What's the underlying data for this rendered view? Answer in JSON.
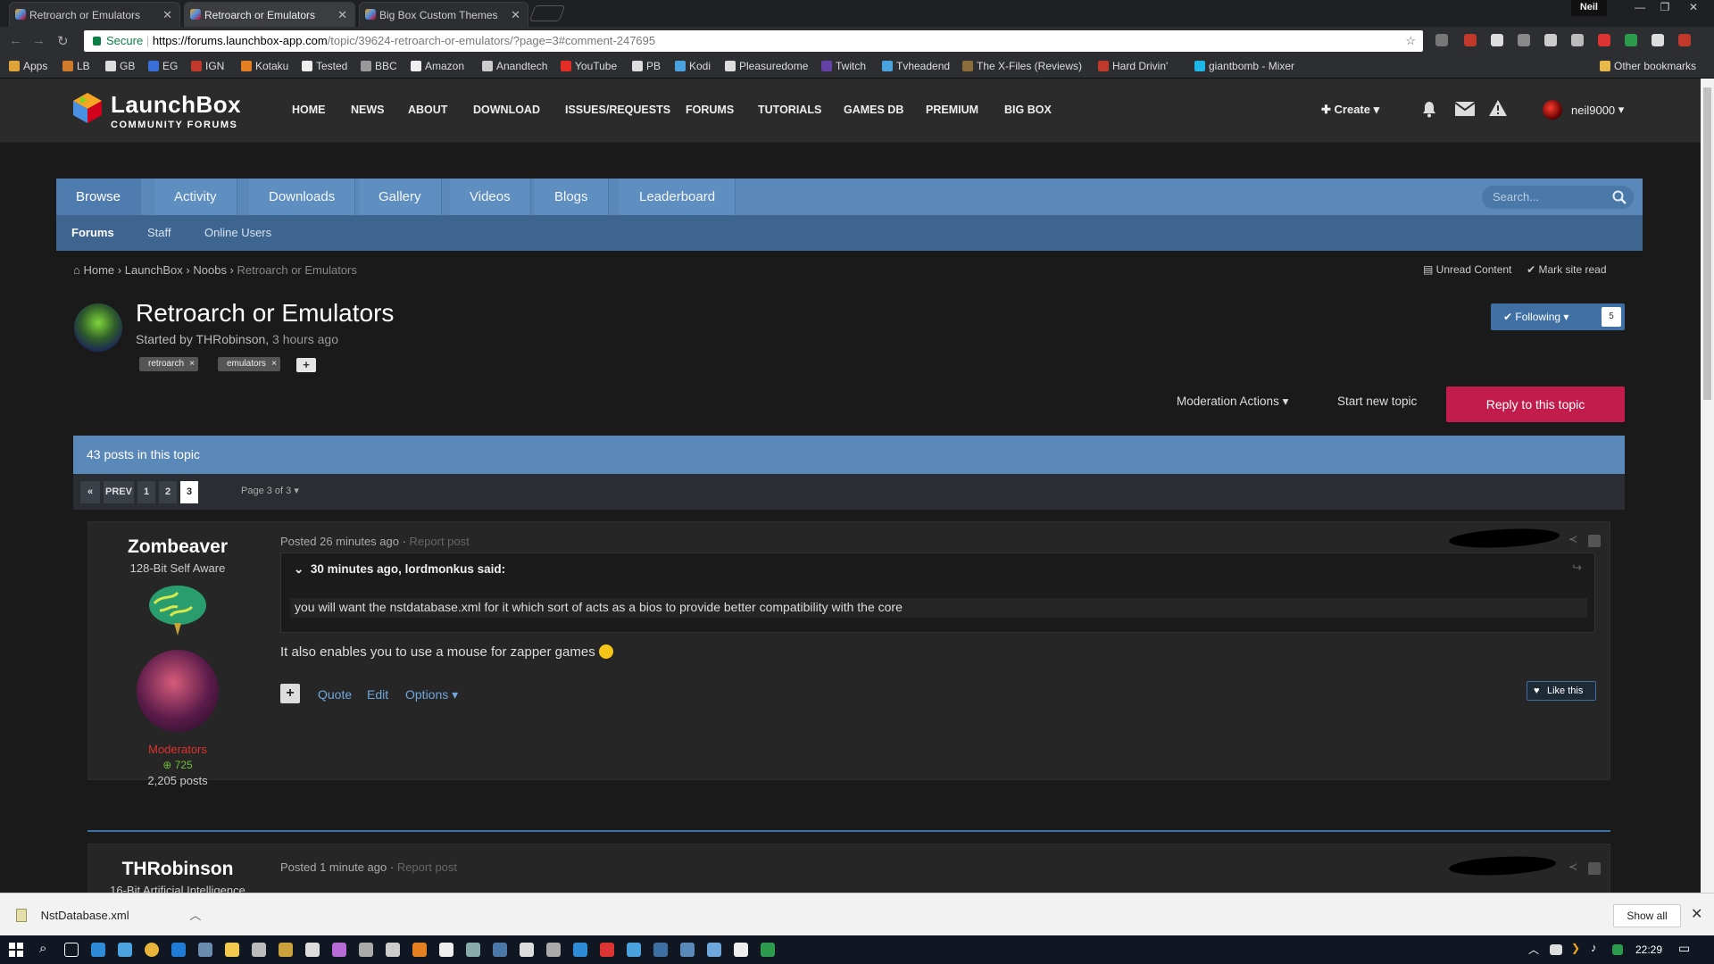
{
  "browser": {
    "tabs": [
      {
        "title": "Retroarch or Emulators"
      },
      {
        "title": "Retroarch or Emulators"
      },
      {
        "title": "Big Box Custom Themes"
      }
    ],
    "profile": "Neil",
    "secure_label": "Secure",
    "url_host": "https://forums.launchbox-app.com",
    "url_path": "/topic/39624-retroarch-or-emulators/?page=3#comment-247695",
    "bookmarks": [
      "Apps",
      "LB",
      "GB",
      "EG",
      "IGN",
      "Kotaku",
      "Tested",
      "BBC",
      "Amazon",
      "Anandtech",
      "YouTube",
      "PB",
      "Kodi",
      "Pleasuredome",
      "Twitch",
      "Tvheadend",
      "The X-Files (Reviews)",
      "Hard Drivin'",
      "giantbomb - Mixer",
      "Other bookmarks"
    ]
  },
  "site": {
    "logo_name": "LaunchBox",
    "logo_sub": "COMMUNITY FORUMS",
    "nav": [
      "HOME",
      "NEWS",
      "ABOUT",
      "DOWNLOAD",
      "ISSUES/REQUESTS",
      "FORUMS",
      "TUTORIALS",
      "GAMES DB",
      "PREMIUM",
      "BIG BOX"
    ],
    "create_label": "Create",
    "username": "neil9000"
  },
  "browse": {
    "tabs": [
      "Browse",
      "Activity",
      "Downloads",
      "Gallery",
      "Videos",
      "Blogs",
      "Leaderboard"
    ],
    "search_placeholder": "Search...",
    "subtabs": [
      "Forums",
      "Staff",
      "Online Users"
    ]
  },
  "breadcrumbs": [
    "Home",
    "LaunchBox",
    "Noobs",
    "Retroarch or Emulators"
  ],
  "top_actions": {
    "unread": "Unread Content",
    "mark_read": "Mark site read"
  },
  "topic": {
    "title": "Retroarch or Emulators",
    "started_prefix": "Started by THRobinson,",
    "started_ago": "3 hours ago",
    "tags": [
      "retroarch",
      "emulators"
    ],
    "following_label": "Following",
    "following_count": "5",
    "moderation_label": "Moderation Actions",
    "start_new_label": "Start new topic",
    "reply_label": "Reply to this topic",
    "posts_count": "43 posts in this topic"
  },
  "pagination": {
    "prev": "PREV",
    "pages": [
      "1",
      "2",
      "3"
    ],
    "current": "3",
    "page_of": "Page 3 of 3"
  },
  "posts": [
    {
      "author": "Zombeaver",
      "rank": "128-Bit Self Aware",
      "group": "Moderators",
      "reputation": "725",
      "post_count": "2,205 posts",
      "posted": "Posted 26 minutes ago",
      "report": "Report post",
      "quote_header": "30 minutes ago, lordmonkus said:",
      "quote_body": "you will want the nstdatabase.xml for it which sort of acts as a bios to provide better compatibility with the core",
      "body": "It also enables you to use a mouse for zapper games",
      "actions": [
        "Quote",
        "Edit",
        "Options"
      ],
      "like_label": "Like this"
    },
    {
      "author": "THRobinson",
      "rank": "16-Bit Artificial Intelligence",
      "posted": "Posted 1 minute ago",
      "report": "Report post"
    }
  ],
  "downloads": {
    "file": "NstDatabase.xml",
    "show_all": "Show all"
  },
  "taskbar": {
    "time": "22:29"
  },
  "colors": {
    "accent_blue": "#5a88b8",
    "reply_red": "#c21c4d",
    "moderator_red": "#e0322b",
    "rep_green": "#6fbf3a"
  }
}
